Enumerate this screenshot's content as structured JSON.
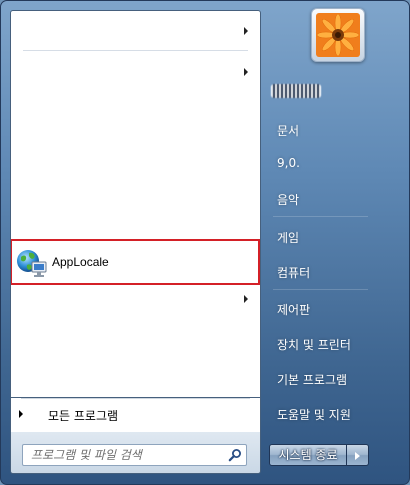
{
  "pinned": {
    "app_label": "AppLocale"
  },
  "all_programs_label": "모든 프로그램",
  "search": {
    "placeholder": "프로그램 및 파일 검색"
  },
  "right_pane": {
    "user_name": "",
    "items": [
      {
        "label": "문서"
      },
      {
        "label": "9,0."
      },
      {
        "label": "음악"
      },
      {
        "label": "게임"
      },
      {
        "label": "컴퓨터"
      },
      {
        "label": "제어판"
      },
      {
        "label": "장치 및 프린터"
      },
      {
        "label": "기본 프로그램"
      },
      {
        "label": "도움말 및 지원"
      }
    ]
  },
  "shutdown": {
    "label": "시스템 종료"
  },
  "colors": {
    "highlight_border": "#d42027",
    "menu_blue": "#5f89b5"
  }
}
